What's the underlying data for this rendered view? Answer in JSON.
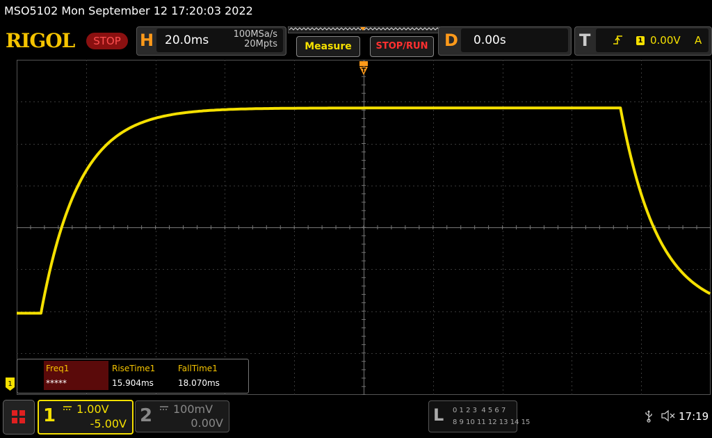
{
  "title_bar": {
    "text": "MSO5102  Mon September 12 17:20:03 2022"
  },
  "header": {
    "logo": "RIGOL",
    "run_state": "STOP",
    "horizontal": {
      "letter": "H",
      "timebase": "20.0ms",
      "sample_rate": "100MSa/s",
      "memory_depth": "20Mpts"
    },
    "measure_label": "Measure",
    "stoprun_label": "STOP/RUN",
    "delay": {
      "letter": "D",
      "value": "0.00s"
    },
    "trigger": {
      "letter": "T",
      "edge_icon": "rising-edge-icon",
      "source": "1",
      "level": "0.00V",
      "mode": "A"
    }
  },
  "colors": {
    "ch1": "#f5e000",
    "accent_orange": "#ff9a1a",
    "stop_red": "#ff3030",
    "grid": "#3a3a3a"
  },
  "trace": {
    "ch1_levels_div": {
      "low": -2.05,
      "high": 2.85
    },
    "rise_start_div": -4.65,
    "fall_start_div": 3.7
  },
  "measurements": {
    "items": [
      {
        "label": "Freq1",
        "value": "*****",
        "selected": true
      },
      {
        "label": "RiseTime1",
        "value": "15.904ms",
        "selected": false
      },
      {
        "label": "FallTime1",
        "value": "18.070ms",
        "selected": false
      }
    ]
  },
  "channel_markers": {
    "ch1": "1"
  },
  "bottom": {
    "ch1": {
      "number": "1",
      "scale": "1.00V",
      "offset": "-5.00V"
    },
    "ch2": {
      "number": "2",
      "scale": "100mV",
      "offset": "0.00V"
    },
    "la": {
      "letter": "L",
      "row1": "0 1 2 3  4 5 6 7",
      "row2": "8 9 10 11 12 13 14 15"
    },
    "clock": "17:19",
    "usb_icon": "usb-icon",
    "sound_icon": "speaker-muted-icon"
  }
}
